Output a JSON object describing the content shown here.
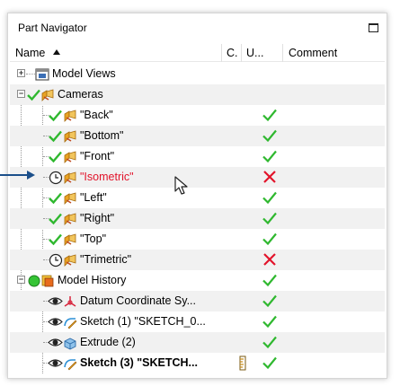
{
  "panel": {
    "title": "Part Navigator"
  },
  "columns": {
    "name": "Name",
    "c": "C.",
    "u": "U...",
    "comment": "Comment"
  },
  "colors": {
    "check": "#2fb82f",
    "cross": "#e2132a",
    "red_text": "#e2132a",
    "arrow": "#1b4f8a"
  },
  "rows": [
    {
      "label": "Model Views",
      "icon": "model-views-icon",
      "status": ""
    },
    {
      "label": "Cameras",
      "icon": "camera-icon",
      "status": ""
    },
    {
      "label": "\"Back\"",
      "icon": "camera-icon",
      "status": "check"
    },
    {
      "label": "\"Bottom\"",
      "icon": "camera-icon",
      "status": "check"
    },
    {
      "label": "\"Front\"",
      "icon": "camera-icon",
      "status": "check"
    },
    {
      "label": "\"Isometric\"",
      "icon": "camera-icon",
      "status": "cross"
    },
    {
      "label": "\"Left\"",
      "icon": "camera-icon",
      "status": "check"
    },
    {
      "label": "\"Right\"",
      "icon": "camera-icon",
      "status": "check"
    },
    {
      "label": "\"Top\"",
      "icon": "camera-icon",
      "status": "check"
    },
    {
      "label": "\"Trimetric\"",
      "icon": "camera-icon",
      "status": "cross"
    },
    {
      "label": "Model History",
      "icon": "model-history-icon",
      "status": "check"
    },
    {
      "label": "Datum Coordinate Sy...",
      "icon": "datum-csys-icon",
      "status": "check"
    },
    {
      "label": "Sketch (1) \"SKETCH_0...",
      "icon": "sketch-icon",
      "status": "check"
    },
    {
      "label": "Extrude (2)",
      "icon": "extrude-icon",
      "status": "check"
    },
    {
      "label": "Sketch (3) \"SKETCH...",
      "icon": "sketch-icon",
      "status": "check"
    }
  ]
}
